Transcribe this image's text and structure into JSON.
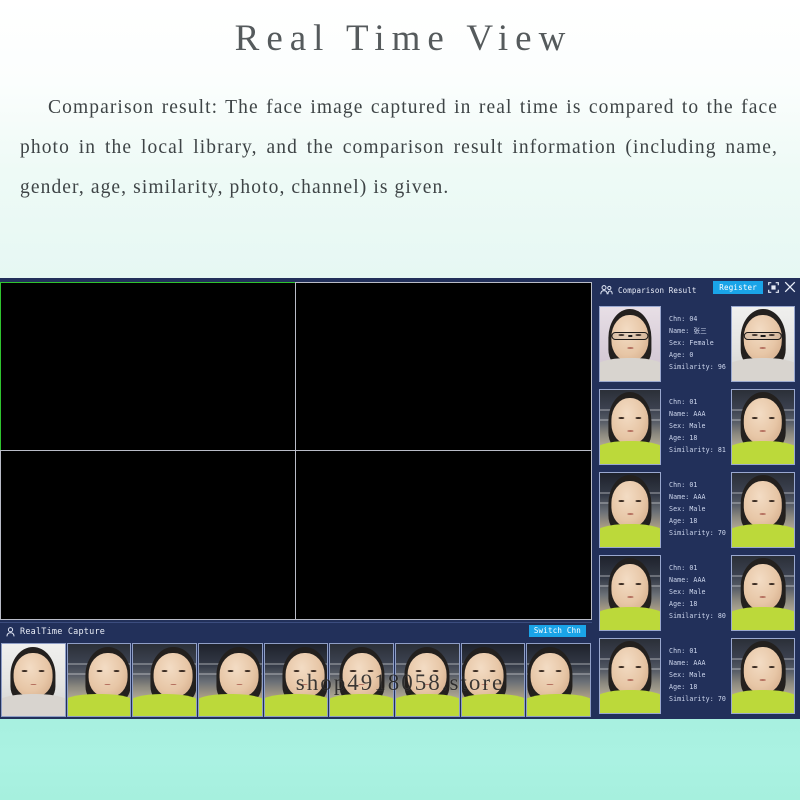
{
  "promo": {
    "title": "Real Time View",
    "body": "Comparison result: The face image captured in real time is compared to the face photo in the local library, and the comparison result information (including name, gender, age, similarity, photo, channel) is given."
  },
  "watermark": "shop4918058.store",
  "colors": {
    "app_background": "#22305a",
    "accent_blue": "#1aa4e8",
    "selected_pane_border": "#2fc42f",
    "unselected_pane_border": "#b9bcc7",
    "footer_band": "#aaf2e2",
    "panel_text": "#cfd8ef"
  },
  "video_wall": {
    "layout": "2x2",
    "panes": [
      {
        "id": "pane-1",
        "selected": true,
        "signal": "none"
      },
      {
        "id": "pane-2",
        "selected": false,
        "signal": "none"
      },
      {
        "id": "pane-3",
        "selected": false,
        "signal": "none"
      },
      {
        "id": "pane-4",
        "selected": false,
        "signal": "none"
      }
    ]
  },
  "capture_panel": {
    "title": "RealTime Capture",
    "icon": "person-icon",
    "switch_label": "Switch Chn",
    "thumbnails": [
      {
        "id": "capture-1",
        "scene": "white",
        "pose": "front"
      },
      {
        "id": "capture-2",
        "scene": "office",
        "pose": "right"
      },
      {
        "id": "capture-3",
        "scene": "office",
        "pose": "right"
      },
      {
        "id": "capture-4",
        "scene": "lab",
        "pose": "right"
      },
      {
        "id": "capture-5",
        "scene": "lab",
        "pose": "right"
      },
      {
        "id": "capture-6",
        "scene": "office",
        "pose": "front"
      },
      {
        "id": "capture-7",
        "scene": "office",
        "pose": "front"
      },
      {
        "id": "capture-8",
        "scene": "lab",
        "pose": "left"
      },
      {
        "id": "capture-9",
        "scene": "lab",
        "pose": "left"
      }
    ]
  },
  "comparison_panel": {
    "title": "Comparison Result",
    "icon": "people-icon",
    "register_label": "Register",
    "maximize_icon": "maximize-icon",
    "close_icon": "close-icon",
    "labels": {
      "chn": "Chn:",
      "name": "Name:",
      "sex": "Sex:",
      "age": "Age:",
      "similarity": "Similarity:"
    },
    "results": [
      {
        "chn": "Chn: 04",
        "name": "Name:  张三",
        "sex": "Sex:  Female",
        "age": "Age:  0",
        "similarity": "Similarity: 96",
        "capture_scene": "pink",
        "library_scene": "white",
        "glasses": true
      },
      {
        "chn": "Chn: 01",
        "name": "Name:  AAA",
        "sex": "Sex:  Male",
        "age": "Age:  18",
        "similarity": "Similarity: 81",
        "capture_scene": "office",
        "library_scene": "office",
        "glasses": false
      },
      {
        "chn": "Chn: 01",
        "name": "Name:  AAA",
        "sex": "Sex:  Male",
        "age": "Age:  18",
        "similarity": "Similarity: 70",
        "capture_scene": "lab",
        "library_scene": "office",
        "glasses": false
      },
      {
        "chn": "Chn: 01",
        "name": "Name:  AAA",
        "sex": "Sex:  Male",
        "age": "Age:  18",
        "similarity": "Similarity: 80",
        "capture_scene": "lab",
        "library_scene": "office",
        "glasses": false
      },
      {
        "chn": "Chn: 01",
        "name": "Name:  AAA",
        "sex": "Sex:  Male",
        "age": "Age:  18",
        "similarity": "Similarity: 70",
        "capture_scene": "office",
        "library_scene": "office",
        "glasses": false
      }
    ]
  }
}
